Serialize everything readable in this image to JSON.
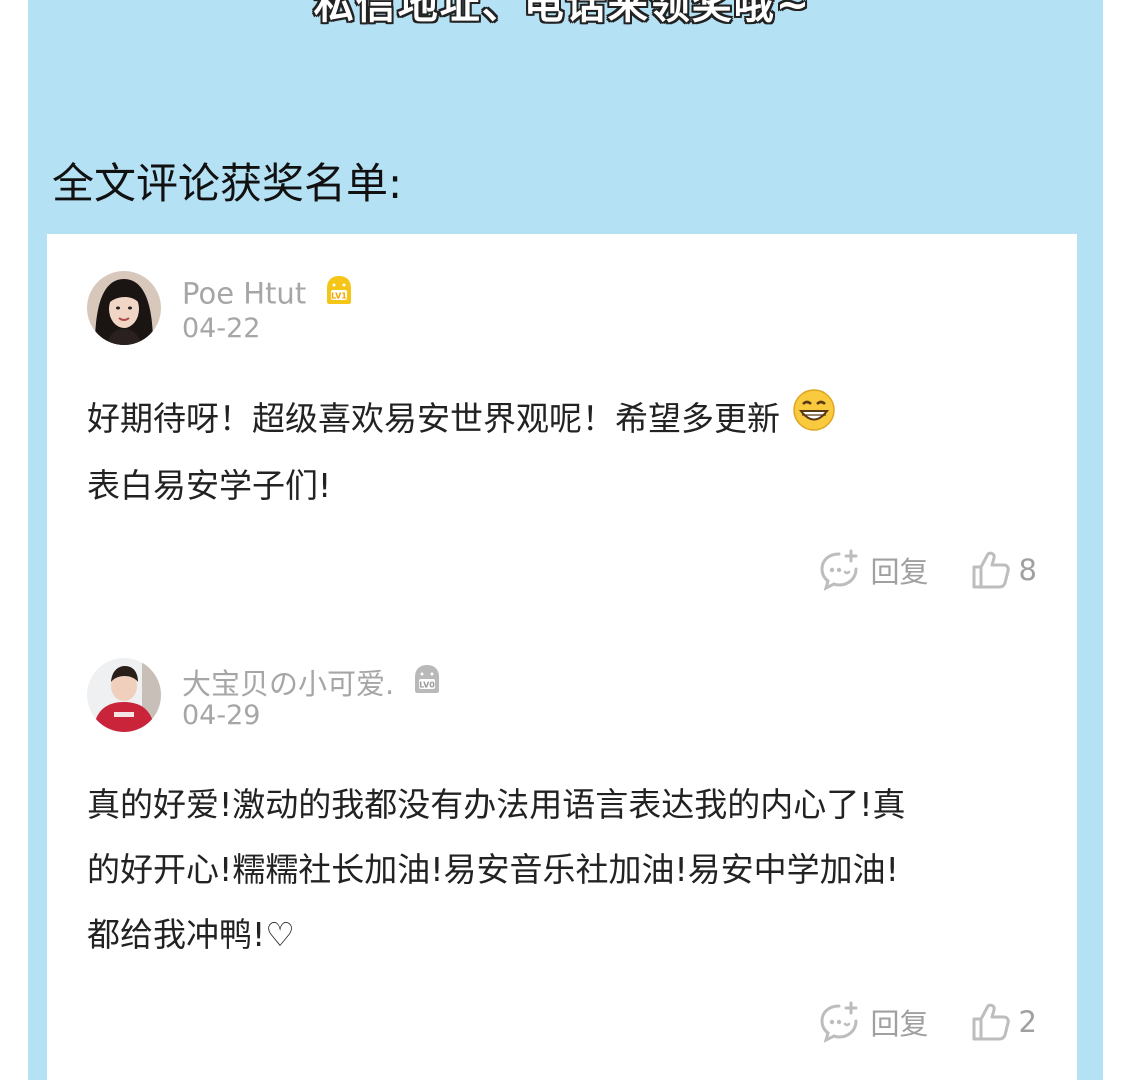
{
  "header": {
    "top_text": "私信地址、电话来领奖哦~",
    "section_title": "全文评论获奖名单:"
  },
  "colors": {
    "panel_bg": "#b5e1f4",
    "card_bg": "#ffffff",
    "muted_text": "#a6a6a6",
    "body_text": "#222222",
    "lv1_badge": "#f5c518",
    "lv0_badge": "#b9b9b9"
  },
  "comments": [
    {
      "username": "Poe Htut",
      "level": "LV1",
      "level_icon": "lv1-badge-icon",
      "date": "04-22",
      "lines": [
        "好期待呀！超级喜欢易安世界观呢！希望多更新",
        "表白易安学子们!"
      ],
      "emoji": "grinning-face-icon",
      "reply_label": "回复",
      "likes": "8"
    },
    {
      "username": "大宝贝の小可爱.",
      "level": "LV0",
      "level_icon": "lv0-badge-icon",
      "date": "04-29",
      "lines": [
        "真的好爱!激动的我都没有办法用语言表达我的内心了!真",
        "的好开心!糯糯社长加油!易安音乐社加油!易安中学加油!",
        "都给我冲鸭!♡"
      ],
      "reply_label": "回复",
      "likes": "2"
    }
  ]
}
